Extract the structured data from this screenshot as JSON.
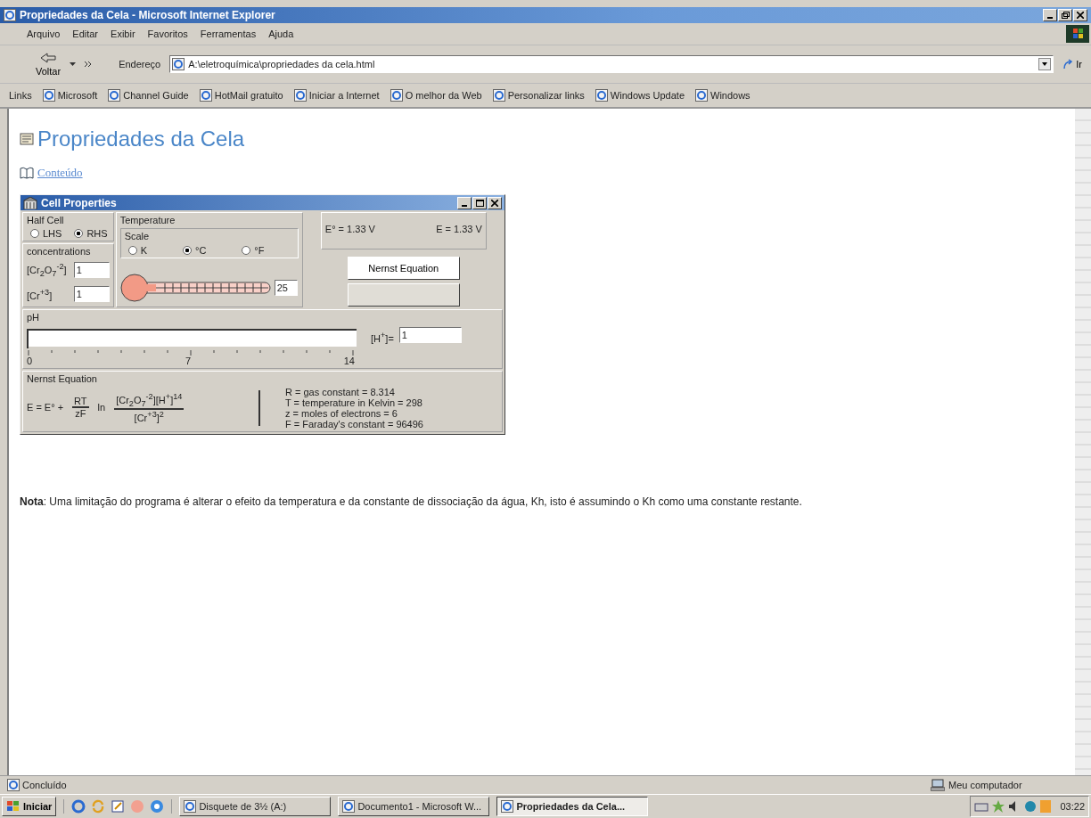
{
  "window": {
    "title": "Propriedades da Cela - Microsoft Internet Explorer"
  },
  "menu": [
    "Arquivo",
    "Editar",
    "Exibir",
    "Favoritos",
    "Ferramentas",
    "Ajuda"
  ],
  "toolbar": {
    "back": "Voltar",
    "address_label": "Endereço",
    "address": "A:\\eletroquímica\\propriedades da cela.html",
    "go": "Ir"
  },
  "links": {
    "label": "Links",
    "items": [
      "Microsoft",
      "Channel Guide",
      "HotMail gratuito",
      "Iniciar a Internet",
      "O melhor da Web",
      "Personalizar links",
      "Windows Update",
      "Windows"
    ]
  },
  "page": {
    "heading": "Propriedades da Cela",
    "contents_link": "Conteúdo",
    "applet": {
      "title": "Cell Properties",
      "half_cell": {
        "label": "Half Cell",
        "options": [
          {
            "label": "LHS",
            "selected": false
          },
          {
            "label": "RHS",
            "selected": true
          }
        ]
      },
      "concentrations": {
        "label": "concentrations",
        "fields": [
          {
            "label": "[Cr$_{2}$O$_{7}$$^{-2}$]",
            "value": "1"
          },
          {
            "label": "[Cr$^{+3}$]",
            "value": "1"
          }
        ]
      },
      "temperature": {
        "label": "Temperature",
        "scale_label": "Scale",
        "options": [
          {
            "label": "K",
            "selected": false
          },
          {
            "label": "°C",
            "selected": true
          },
          {
            "label": "°F",
            "selected": false
          }
        ],
        "value": "25"
      },
      "readouts": [
        "E° = 1.33 V",
        "E = 1.33 V"
      ],
      "buttons": [
        {
          "label": "Nernst Equation",
          "disabled": false
        },
        {
          "disabled": true
        }
      ],
      "ph": {
        "label": "pH",
        "level": 0,
        "ticks": [
          "0",
          "7",
          "14"
        ],
        "h_label": "[H$^{+}$]=",
        "h_value": "1"
      },
      "nernst": {
        "label": "Nernst Equation",
        "lhs": "E = E° +",
        "rt": "RT",
        "zf": "zF",
        "ln": "ln",
        "numerator": "[Cr$_{2}$O$_{7}$$^{-2}$][H$^{+}$]$^{14}$",
        "denominator": "[Cr$^{+3}$]$^{2}$",
        "constants": [
          "R = gas constant = 8.314",
          "T = temperature in Kelvin = 298",
          "z = moles of electrons = 6",
          "F = Faraday's constant = 96496"
        ]
      }
    },
    "note": "**Nota**: Uma limitação do programa é alterar o efeito da temperatura e da constante de dissociação da água, Kh, isto é assumindo o Kh como uma constante restante."
  },
  "status_bar": {
    "text": "Concluído",
    "zone": "Meu computador"
  },
  "taskbar": {
    "start": "Iniciar",
    "tasks": [
      {
        "label": "Disquete de 3½ (A:)",
        "selected": false
      },
      {
        "label": "Documento1 - Microsoft W...",
        "selected": false
      },
      {
        "label": "Propriedades da Cela...",
        "selected": true
      }
    ],
    "clock": "03:22"
  }
}
